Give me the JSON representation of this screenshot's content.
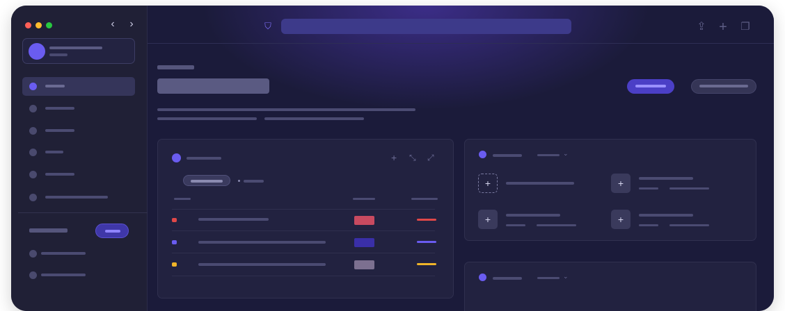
{
  "window": {
    "traffic_lights": {
      "close": "#ff5f57",
      "minimize": "#febc2e",
      "maximize": "#28c840"
    },
    "back_icon": "chevron-left-icon",
    "forward_icon": "chevron-right-icon"
  },
  "sidebar": {
    "profile": {
      "name": "",
      "subtitle": ""
    },
    "items": [
      {
        "label": "",
        "active": true
      },
      {
        "label": "",
        "active": false
      },
      {
        "label": "",
        "active": false
      },
      {
        "label": "",
        "active": false
      },
      {
        "label": "",
        "active": false
      },
      {
        "label": "",
        "active": false
      }
    ],
    "section": {
      "title": "",
      "button_label": ""
    },
    "section_items": [
      {
        "label": ""
      },
      {
        "label": ""
      }
    ]
  },
  "toolbar": {
    "address": "",
    "icons": [
      "shield-icon",
      "share-icon",
      "plus-icon",
      "tabs-icon"
    ]
  },
  "page": {
    "eyebrow": "",
    "title": "",
    "description": [
      "",
      "",
      ""
    ],
    "primary_button": "",
    "secondary_button": ""
  },
  "left_panel": {
    "title": "",
    "filter_chip": "",
    "filter_text": "",
    "columns": [
      "",
      "",
      ""
    ],
    "rows": [
      {
        "name": "",
        "color": "#e04848",
        "status_color": "#e04848"
      },
      {
        "name": "",
        "color": "#6a5cf0",
        "status_color": "#6a5cf0"
      },
      {
        "name": "",
        "color": "#f0b429",
        "status_color": "#f0b429"
      }
    ],
    "icons": [
      "plus-icon",
      "collapse-icon",
      "expand-icon"
    ]
  },
  "right_panel": {
    "title": "",
    "dropdown": "",
    "tiles": [
      {
        "title": "",
        "meta": [
          "",
          ""
        ]
      },
      {
        "title": "",
        "meta": [
          "",
          ""
        ]
      },
      {
        "title": "",
        "meta": [
          "",
          ""
        ]
      },
      {
        "title": "",
        "meta": [
          "",
          ""
        ]
      }
    ]
  },
  "bottom_panel": {
    "title": "",
    "dropdown": ""
  },
  "colors": {
    "accent": "#6a5cf0",
    "background": "#1b1b3a",
    "sidebar": "#202036"
  }
}
